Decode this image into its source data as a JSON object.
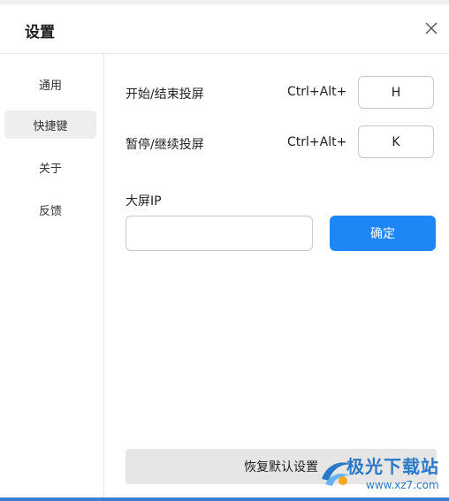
{
  "window": {
    "title": "设置"
  },
  "sidebar": {
    "items": [
      {
        "label": "通用"
      },
      {
        "label": "快捷键"
      },
      {
        "label": "关于"
      },
      {
        "label": "反馈"
      }
    ]
  },
  "shortcuts": [
    {
      "label": "开始/结束投屏",
      "modifier": "Ctrl+Alt+",
      "key": "H"
    },
    {
      "label": "暂停/继续投屏",
      "modifier": "Ctrl+Alt+",
      "key": "K"
    }
  ],
  "screen_ip": {
    "label": "大屏IP",
    "value": "",
    "confirm_label": "确定"
  },
  "footer": {
    "reset_label": "恢复默认设置"
  },
  "watermark": {
    "name": "极光下载站",
    "url": "www.xz7.com"
  },
  "colors": {
    "accent": "#1f87f5",
    "nav_active": "#eeeeee",
    "reset_bg": "#e6e6e6"
  }
}
